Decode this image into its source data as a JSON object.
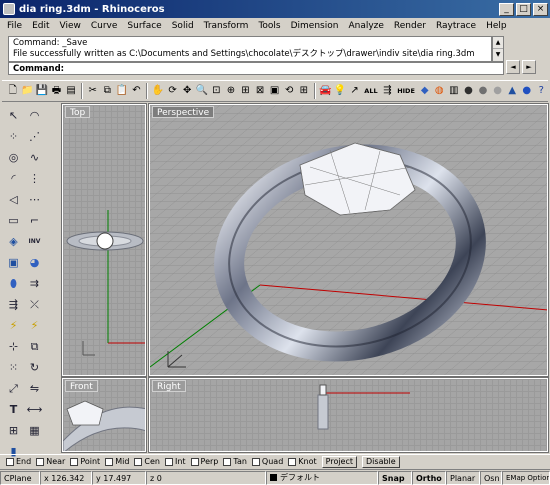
{
  "window": {
    "title": "dia ring.3dm - Rhinoceros",
    "min": "_",
    "max": "□",
    "close": "×"
  },
  "menu": [
    "File",
    "Edit",
    "View",
    "Curve",
    "Surface",
    "Solid",
    "Transform",
    "Tools",
    "Dimension",
    "Analyze",
    "Render",
    "Raytrace",
    "Help"
  ],
  "command": {
    "history_line1": "Command: _Save",
    "history_line2": "File successfully written as C:\\Documents and Settings\\chocolate\\デスクトップ\\drawer\\indiv site\\dia ring.3dm",
    "prompt": "Command:",
    "value": "",
    "scroll_up": "▲",
    "scroll_down": "▼",
    "side_left": "◄",
    "side_right": "►"
  },
  "toolbar_text": {
    "all": "ALL",
    "hide": "HIDE"
  },
  "viewports": {
    "top": "Top",
    "perspective": "Perspective",
    "front": "Front",
    "right": "Right"
  },
  "osnap": {
    "items": [
      "End",
      "Near",
      "Point",
      "Mid",
      "Cen",
      "Int",
      "Perp",
      "Tan",
      "Quad",
      "Knot"
    ],
    "project": "Project",
    "disable": "Disable"
  },
  "status": {
    "cplane": "CPlane",
    "x": "x 126.342",
    "y": "y 17.497",
    "z": "z 0",
    "layer": "デフォルト",
    "snap": "Snap",
    "ortho": "Ortho",
    "planar": "Planar",
    "osnap": "Osn",
    "emap": "EMap Options"
  },
  "colors": {
    "titlebar_start": "#0a246a",
    "titlebar_end": "#3a6ea5",
    "viewport_bg": "#a5a5a5",
    "x_axis": "#c00000",
    "y_axis": "#008000"
  }
}
